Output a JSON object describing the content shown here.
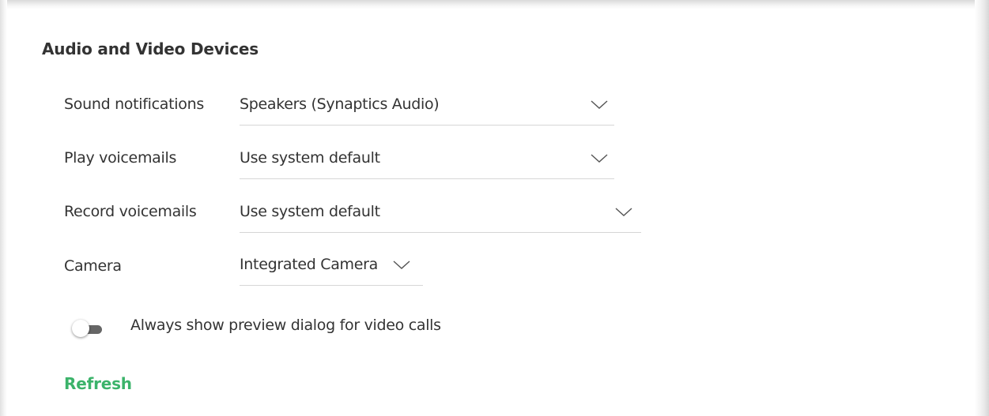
{
  "section": {
    "title": "Audio and Video Devices"
  },
  "rows": [
    {
      "label": "Sound notifications",
      "value": "Speakers (Synaptics Audio)"
    },
    {
      "label": "Play voicemails",
      "value": "Use system default"
    },
    {
      "label": "Record voicemails",
      "value": "Use system default"
    },
    {
      "label": "Camera",
      "value": "Integrated Camera"
    }
  ],
  "preview_toggle": {
    "label": "Always show preview dialog for video calls",
    "state": "off"
  },
  "refresh": {
    "label": "Refresh",
    "color": "#3bb36a"
  },
  "icons": {
    "dropdown": "chevron-down-icon"
  }
}
